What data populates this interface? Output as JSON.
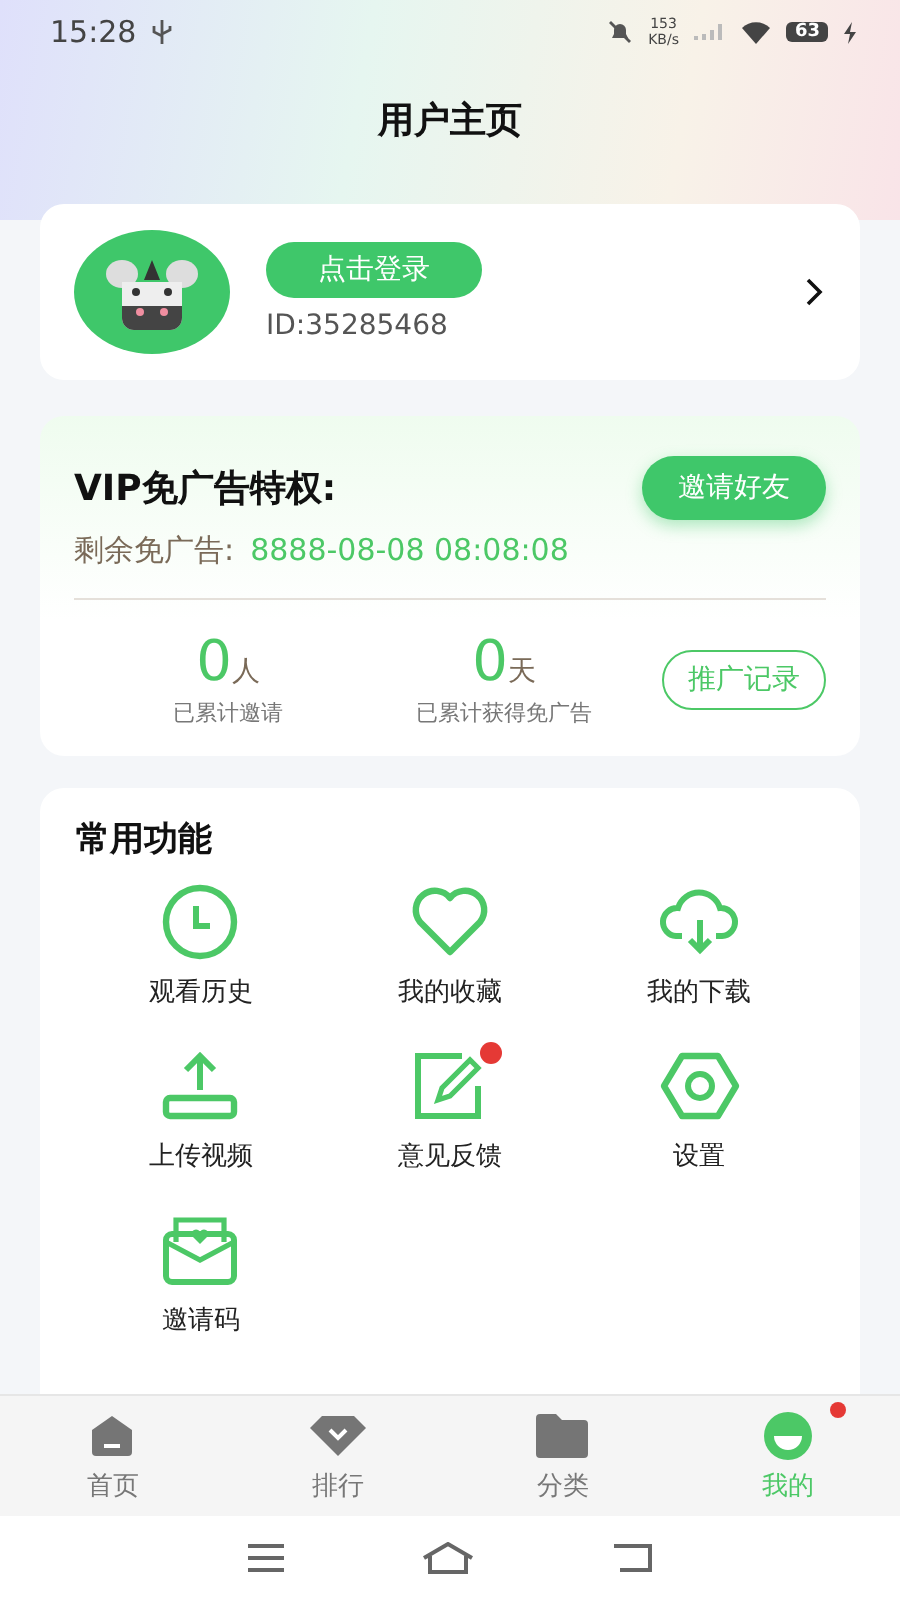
{
  "status_bar": {
    "time": "15:28",
    "speed": "153",
    "speed_unit": "KB/s",
    "battery": "63"
  },
  "title": "用户主页",
  "user": {
    "login_button": "点击登录",
    "id": "ID:35285468"
  },
  "vip": {
    "title": "VIP免广告特权:",
    "invite_button": "邀请好友",
    "remaining_label": "剩余免广告:",
    "remaining_value": "8888-08-08 08:08:08",
    "stats": [
      {
        "value": "0",
        "unit": "人",
        "label": "已累计邀请"
      },
      {
        "value": "0",
        "unit": "天",
        "label": "已累计获得免广告"
      }
    ],
    "record_button": "推广记录"
  },
  "functions": {
    "title": "常用功能",
    "items": [
      {
        "kind": "clock",
        "label": "观看历史",
        "badge": false
      },
      {
        "kind": "heart",
        "label": "我的收藏",
        "badge": false
      },
      {
        "kind": "cloud",
        "label": "我的下载",
        "badge": false
      },
      {
        "kind": "upload",
        "label": "上传视频",
        "badge": false
      },
      {
        "kind": "edit",
        "label": "意见反馈",
        "badge": true
      },
      {
        "kind": "settings",
        "label": "设置",
        "badge": false
      },
      {
        "kind": "mail",
        "label": "邀请码",
        "badge": false
      }
    ]
  },
  "tabs": [
    {
      "kind": "home",
      "label": "首页",
      "selected": false,
      "badge": false
    },
    {
      "kind": "rank",
      "label": "排行",
      "selected": false,
      "badge": false
    },
    {
      "kind": "folder",
      "label": "分类",
      "selected": false,
      "badge": false
    },
    {
      "kind": "me",
      "label": "我的",
      "selected": true,
      "badge": true
    }
  ]
}
